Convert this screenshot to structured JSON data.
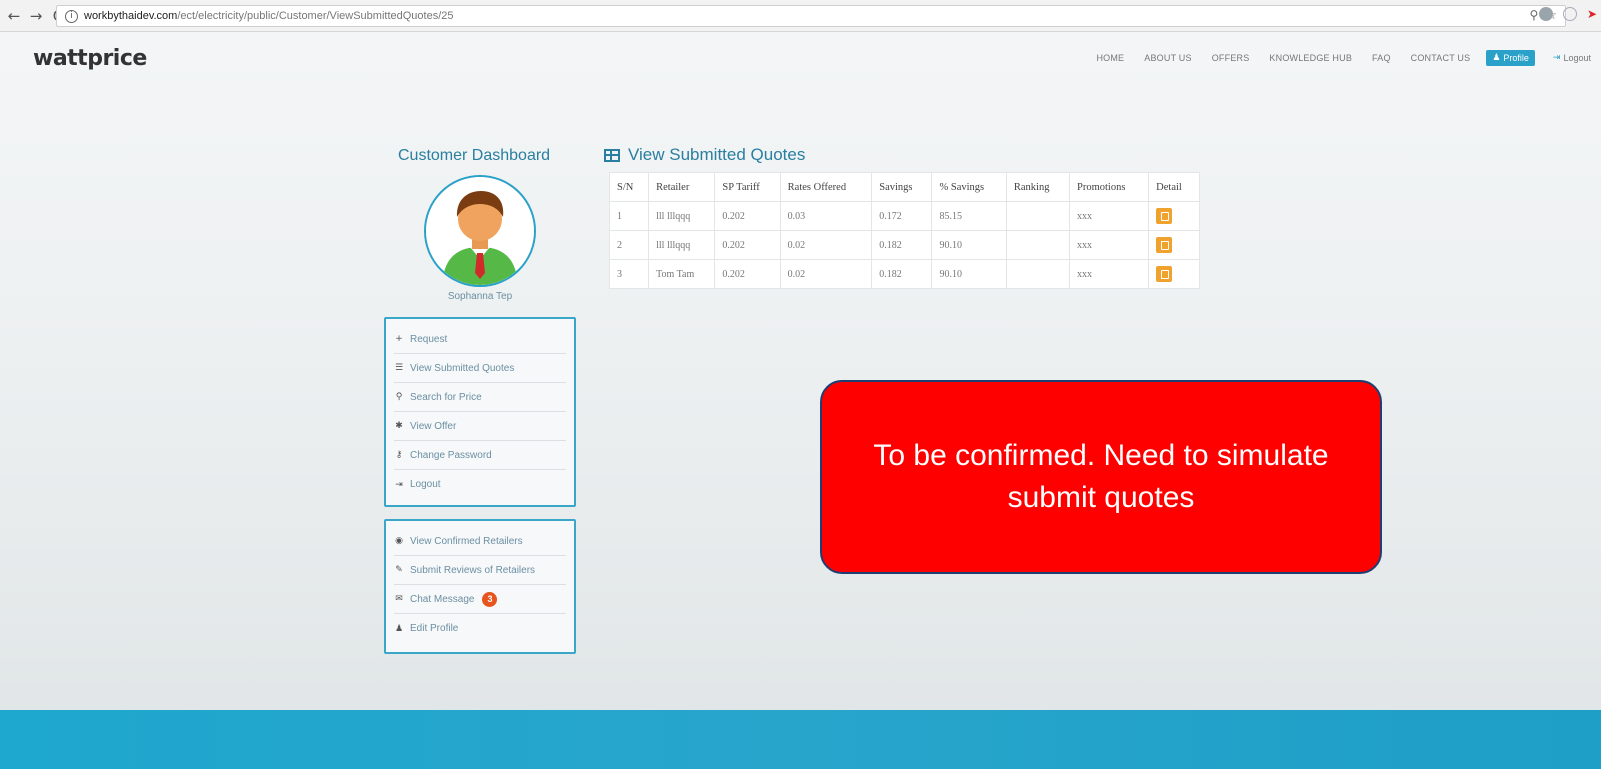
{
  "browser": {
    "url_domain": "workbythaidev.com",
    "url_path": "/ect/electricity/public/Customer/ViewSubmittedQuotes/25"
  },
  "site": {
    "logo": "wattprice",
    "nav": [
      "HOME",
      "ABOUT US",
      "OFFERS",
      "KNOWLEDGE HUB",
      "FAQ",
      "CONTACT US"
    ],
    "profile_label": "Profile",
    "logout_label": "Logout"
  },
  "sidebar": {
    "title": "Customer Dashboard",
    "user_name": "Sophanna Tep",
    "menu1": [
      {
        "icon": "plus-icon",
        "label": "Request"
      },
      {
        "icon": "list-icon",
        "label": "View Submitted Quotes"
      },
      {
        "icon": "search-icon",
        "label": "Search for Price"
      },
      {
        "icon": "asterisk-icon",
        "label": "View Offer"
      },
      {
        "icon": "key-icon",
        "label": "Change Password"
      },
      {
        "icon": "logout-icon",
        "label": "Logout"
      }
    ],
    "menu2": [
      {
        "icon": "eye-icon",
        "label": "View Confirmed Retailers"
      },
      {
        "icon": "pencil-icon",
        "label": "Submit Reviews of Retailers"
      },
      {
        "icon": "chat-icon",
        "label": "Chat Message",
        "badge": "3"
      },
      {
        "icon": "user-icon",
        "label": "Edit Profile"
      }
    ]
  },
  "main": {
    "title": "View Submitted Quotes",
    "columns": [
      "S/N",
      "Retailer",
      "SP Tariff",
      "Rates Offered",
      "Savings",
      "% Savings",
      "Ranking",
      "Promotions",
      "Detail"
    ],
    "rows": [
      [
        "1",
        "lll lllqqq",
        "0.202",
        "0.03",
        "0.172",
        "85.15",
        "",
        "xxx"
      ],
      [
        "2",
        "lll lllqqq",
        "0.202",
        "0.02",
        "0.182",
        "90.10",
        "",
        "xxx"
      ],
      [
        "3",
        "Tom Tam",
        "0.202",
        "0.02",
        "0.182",
        "90.10",
        "",
        "xxx"
      ]
    ]
  },
  "callout": {
    "text": "To be confirmed. Need to simulate submit quotes"
  },
  "colors": {
    "accent": "#2aa1c8",
    "callout_bg": "#ff0000",
    "detail_button": "#f0a22e",
    "badge": "#e8541e"
  }
}
